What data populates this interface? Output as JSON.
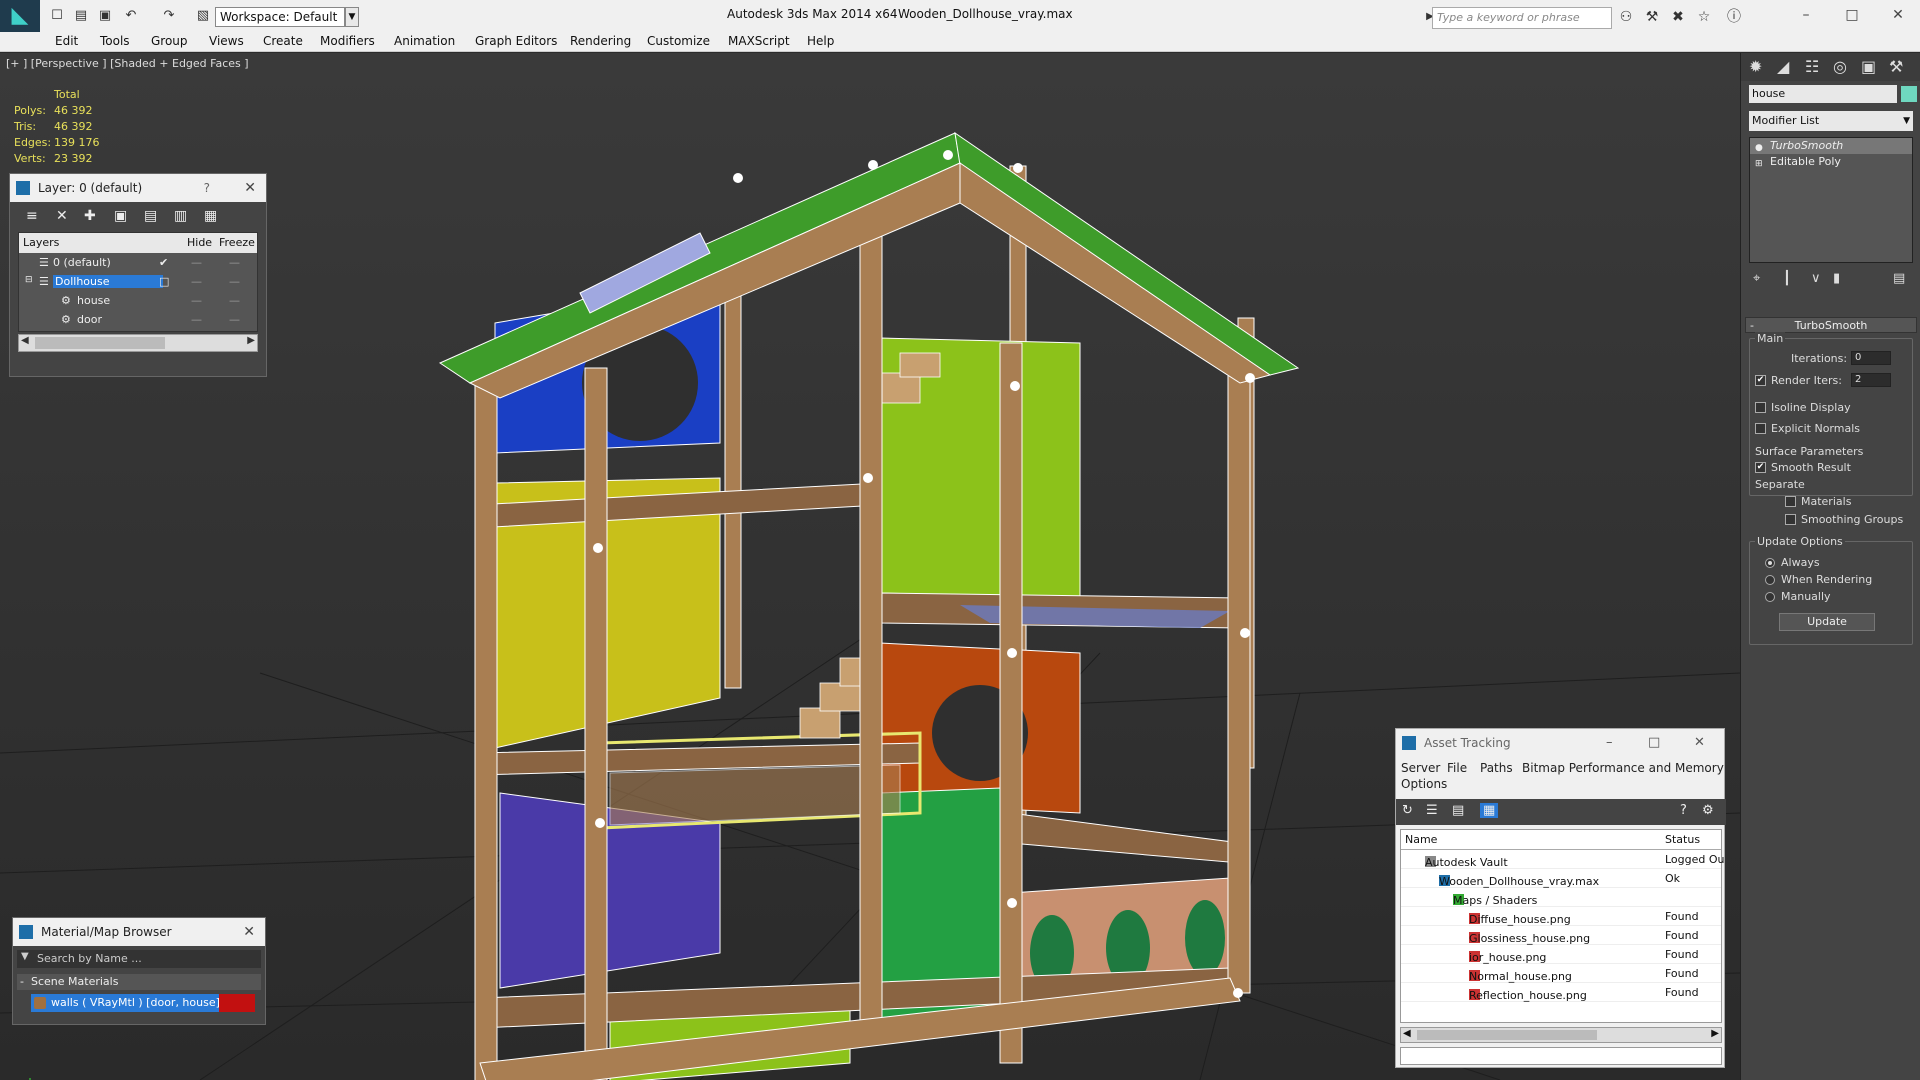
{
  "titlebar": {
    "app_title": "Autodesk 3ds Max  2014 x64",
    "file_title": "Wooden_Dollhouse_vray.max",
    "workspace": "Workspace: Default",
    "search_placeholder": "Type a keyword or phrase"
  },
  "menu": [
    "Edit",
    "Tools",
    "Group",
    "Views",
    "Create",
    "Modifiers",
    "Animation",
    "Graph Editors",
    "Rendering",
    "Customize",
    "MAXScript",
    "Help"
  ],
  "viewport": {
    "label": "[+ ] [Perspective ] [Shaded + Edged Faces ]",
    "stats": {
      "header": "Total",
      "rows": [
        {
          "label": "Polys:",
          "value": "46 392"
        },
        {
          "label": "Tris:",
          "value": "46 392"
        },
        {
          "label": "Edges:",
          "value": "139 176"
        },
        {
          "label": "Verts:",
          "value": "23 392"
        }
      ]
    }
  },
  "layer_panel": {
    "title": "Layer: 0 (default)",
    "help": "?",
    "columns": [
      "Layers",
      "Hide",
      "Freeze"
    ],
    "rows": [
      {
        "name": "0 (default)",
        "current": true
      },
      {
        "name": "Dollhouse",
        "selected": true
      },
      {
        "name": "house"
      },
      {
        "name": "door"
      }
    ]
  },
  "command_panel": {
    "object_name": "house",
    "modifier_list": "Modifier List",
    "stack": [
      "TurboSmooth",
      "Editable Poly"
    ],
    "rollout_title": "TurboSmooth",
    "main_group": "Main",
    "iterations_label": "Iterations:",
    "iterations_value": "0",
    "render_iters_label": "Render Iters:",
    "render_iters_value": "2",
    "isoline_display": "Isoline Display",
    "explicit_normals": "Explicit Normals",
    "surface_parameters": "Surface Parameters",
    "smooth_result": "Smooth Result",
    "separate": "Separate",
    "materials": "Materials",
    "smoothing_groups": "Smoothing Groups",
    "update_options": "Update Options",
    "always": "Always",
    "when_rendering": "When Rendering",
    "manually": "Manually",
    "update_button": "Update"
  },
  "asset_tracking": {
    "title": "Asset Tracking",
    "menu": [
      "Server",
      "File",
      "Paths",
      "Bitmap Performance and Memory",
      "Options"
    ],
    "columns": [
      "Name",
      "Status"
    ],
    "rows": [
      {
        "name": "Autodesk Vault",
        "status": "Logged Ou"
      },
      {
        "name": "Wooden_Dollhouse_vray.max",
        "status": "Ok"
      },
      {
        "name": "Maps / Shaders",
        "status": ""
      },
      {
        "name": "Diffuse_house.png",
        "status": "Found"
      },
      {
        "name": "Glossiness_house.png",
        "status": "Found"
      },
      {
        "name": "ior_house.png",
        "status": "Found"
      },
      {
        "name": "Normal_house.png",
        "status": "Found"
      },
      {
        "name": "Reflection_house.png",
        "status": "Found"
      }
    ]
  },
  "material_browser": {
    "title": "Material/Map Browser",
    "search_placeholder": "Search by Name ...",
    "group": "Scene Materials",
    "material": "walls  ( VRayMtl ) [door, house]"
  },
  "colors": {
    "roof": "#3e9c2a",
    "wood": "#a97e52",
    "blue_wall": "#1a3fc4",
    "yellow_wall": "#c8c01a",
    "lime_wall": "#8cc21a",
    "orange_wall": "#b8480e",
    "purple_wall": "#4a3aa8",
    "door_green": "#23a043",
    "selection": "#2a7ad6"
  }
}
